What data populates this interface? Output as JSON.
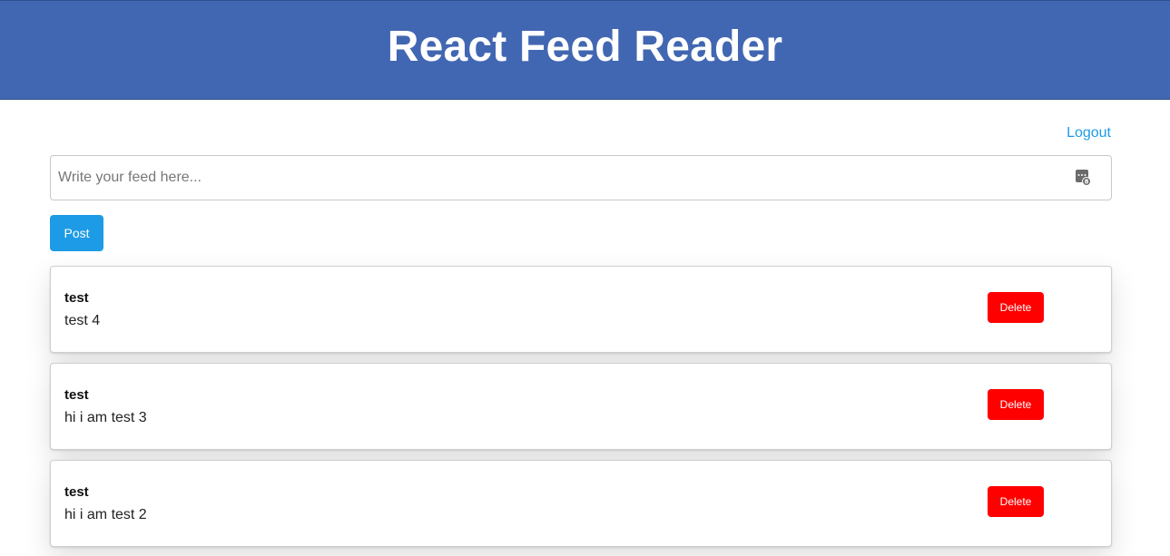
{
  "header": {
    "title": "React Feed Reader",
    "background": "#4267b2"
  },
  "nav": {
    "logout_label": "Logout"
  },
  "composer": {
    "placeholder": "Write your feed here...",
    "value": "",
    "field_icon": "password-manager-icon",
    "post_label": "Post"
  },
  "feed": {
    "items": [
      {
        "author": "test",
        "text": "test 4",
        "delete_label": "Delete"
      },
      {
        "author": "test",
        "text": "hi i am test 3",
        "delete_label": "Delete"
      },
      {
        "author": "test",
        "text": "hi i am test 2",
        "delete_label": "Delete"
      }
    ]
  },
  "colors": {
    "accent": "#1e9be6",
    "danger": "#ff0000"
  }
}
